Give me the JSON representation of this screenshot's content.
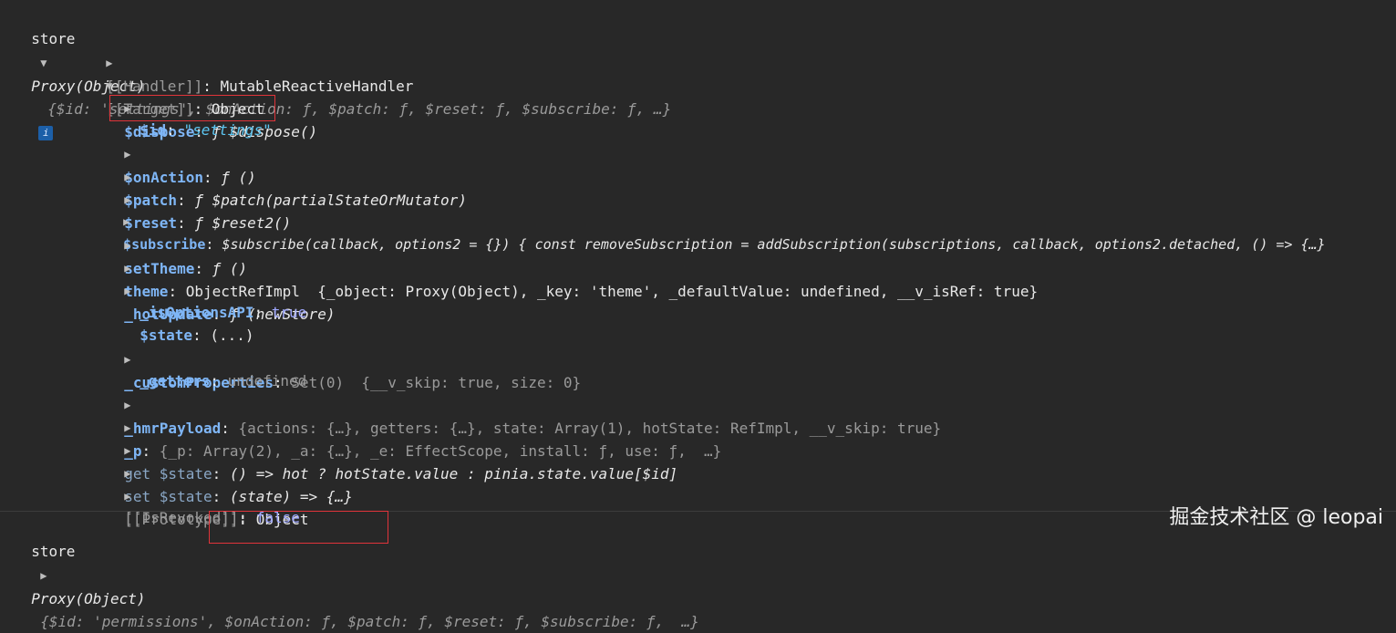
{
  "header": {
    "label": "store",
    "type": "Proxy(Object)",
    "preview": "{$id: 'settings', $onAction: ƒ, $patch: ƒ, $reset: ƒ, $subscribe: ƒ, …}",
    "info": "i"
  },
  "rows": [
    {
      "k": "[[Handler]]",
      "v": "MutableReactiveHandler"
    },
    {
      "k": "[[Target]]",
      "v": "Object"
    },
    {
      "k": "$dispose",
      "v": "ƒ $dispose()"
    },
    {
      "k": "$id",
      "v": "\"settings\""
    },
    {
      "k": "$onAction",
      "v": "ƒ ()"
    },
    {
      "k": "$patch",
      "v": "ƒ $patch(partialStateOrMutator)"
    },
    {
      "k": "$reset",
      "v": "ƒ $reset2()"
    },
    {
      "k": "$subscribe",
      "v": "$subscribe(callback, options2 = {}) { const removeSubscription = addSubscription(subscriptions, callback, options2.detached, () => {…}"
    },
    {
      "k": "setTheme",
      "v": "ƒ ()"
    },
    {
      "k": "theme",
      "v": "ObjectRefImpl  {_object: Proxy(Object), _key: 'theme', _defaultValue: undefined, __v_isRef: true}"
    },
    {
      "k": "_hotUpdate",
      "v": "ƒ (newStore)"
    },
    {
      "k": "_isOptionsAPI",
      "v": "true"
    },
    {
      "k": "$state",
      "v": "(...)"
    },
    {
      "k": "_customProperties",
      "v": "Set(0)  {__v_skip: true, size: 0}"
    },
    {
      "k": "_getters",
      "v": "undefined"
    },
    {
      "k": "_hmrPayload",
      "v": "{actions: {…}, getters: {…}, state: Array(1), hotState: RefImpl, __v_skip: true}"
    },
    {
      "k": "_p",
      "v": "{_p: Array(2), _a: {…}, _e: EffectScope, install: ƒ, use: ƒ,  …}"
    },
    {
      "k": "get $state",
      "v": "() => hot ? hotState.value : pinia.state.value[$id]"
    },
    {
      "k": "set $state",
      "v": "(state) => {…}"
    },
    {
      "k": "[[Prototype]]",
      "v": "Object"
    },
    {
      "k": "[[IsRevoked]]",
      "v": "false"
    }
  ],
  "footer": {
    "label": "store",
    "type": "Proxy(Object)",
    "preview": "{$id: 'permissions', $onAction: ƒ, $patch: ƒ, $reset: ƒ, $subscribe: ƒ,  …}"
  },
  "watermark": "掘金技术社区 @ leopai"
}
